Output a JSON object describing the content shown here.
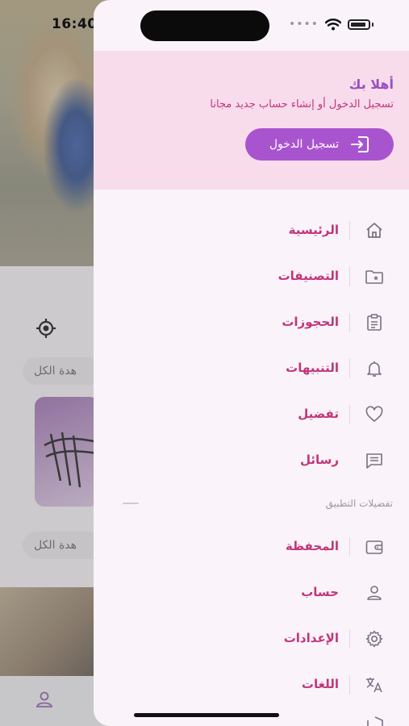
{
  "status_bar": {
    "time": "16:40"
  },
  "background": {
    "see_all_label_1": "هدة الكل",
    "see_all_label_2": "هدة الكل"
  },
  "drawer": {
    "header": {
      "welcome": "أهلا بك",
      "subtitle": "تسجيل الدخول أو إنشاء حساب جديد مجانا",
      "login_button": "تسجيل الدخول"
    },
    "menu": [
      {
        "label": "الرئيسية",
        "icon": "home-icon"
      },
      {
        "label": "التصنيفات",
        "icon": "folder-star-icon"
      },
      {
        "label": "الحجوزات",
        "icon": "clipboard-list-icon"
      },
      {
        "label": "التنبيهات",
        "icon": "bell-icon"
      },
      {
        "label": "تفضيل",
        "icon": "heart-icon"
      },
      {
        "label": "رسائل",
        "icon": "message-icon"
      }
    ],
    "section_title": "تفضيلات التطبيق",
    "preferences": [
      {
        "label": "المحفظة",
        "icon": "wallet-icon"
      },
      {
        "label": "حساب",
        "icon": "user-icon"
      },
      {
        "label": "الإعدادات",
        "icon": "gear-icon"
      },
      {
        "label": "اللغات",
        "icon": "translate-icon"
      }
    ]
  },
  "colors": {
    "accent": "#a954cf",
    "label": "#c2357a",
    "header_bg": "#f8dcec",
    "drawer_bg": "#faf3fa"
  }
}
